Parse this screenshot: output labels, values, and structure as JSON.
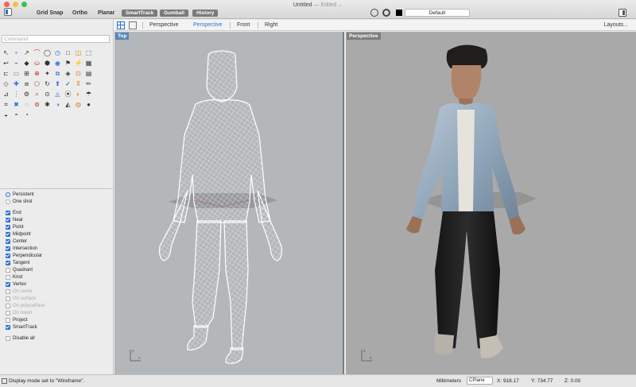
{
  "titlebar": {
    "toggles": [
      "Grid Snap",
      "Ortho",
      "Planar"
    ],
    "pills": [
      "SmartTrack",
      "Gumball",
      "History"
    ],
    "doc_name": "Untitled",
    "doc_state": " — Edited ⌄",
    "display_mode": "Default"
  },
  "sidebar": {
    "command_placeholder": "Command",
    "tool_icons": [
      "↖",
      "∘",
      "↗",
      "⌒",
      "◯",
      "◷",
      "□",
      "◫",
      "⬚",
      "↩",
      "⌁",
      "◆",
      "⛀",
      "⬢",
      "◉",
      "⚑",
      "⚡",
      "▦",
      "⊏",
      "▭",
      "⊞",
      "⊕",
      "✦",
      "⧉",
      "◈",
      "⊡",
      "▤",
      "◇",
      "✚",
      "⧈",
      "⬡",
      "↻",
      "⬆",
      "✓",
      "⊼",
      "✏",
      "⊿",
      "⋮",
      "⚙",
      "⌕",
      "⊙",
      "◬",
      "⦿",
      "◐",
      "☂",
      "⌗",
      "✖",
      "◌",
      "⊚",
      "✱",
      "◑",
      "◭",
      "◍",
      "●",
      "◒",
      "◓",
      "◔"
    ],
    "osnaps": {
      "mode": [
        {
          "label": "Persistent",
          "on": true
        },
        {
          "label": "One shot",
          "on": false
        }
      ],
      "items": [
        {
          "label": "End",
          "on": true,
          "enabled": true
        },
        {
          "label": "Near",
          "on": true,
          "enabled": true
        },
        {
          "label": "Point",
          "on": true,
          "enabled": true
        },
        {
          "label": "Midpoint",
          "on": true,
          "enabled": true
        },
        {
          "label": "Center",
          "on": true,
          "enabled": true
        },
        {
          "label": "Intersection",
          "on": true,
          "enabled": true
        },
        {
          "label": "Perpendicular",
          "on": true,
          "enabled": true
        },
        {
          "label": "Tangent",
          "on": true,
          "enabled": true
        },
        {
          "label": "Quadrant",
          "on": false,
          "enabled": true
        },
        {
          "label": "Knot",
          "on": false,
          "enabled": true
        },
        {
          "label": "Vertex",
          "on": true,
          "enabled": true
        },
        {
          "label": "On curve",
          "on": false,
          "enabled": false
        },
        {
          "label": "On surface",
          "on": false,
          "enabled": false
        },
        {
          "label": "On polysurface",
          "on": false,
          "enabled": false
        },
        {
          "label": "On mesh",
          "on": false,
          "enabled": false
        },
        {
          "label": "Project",
          "on": false,
          "enabled": true
        },
        {
          "label": "SmartTrack",
          "on": true,
          "enabled": true
        }
      ],
      "disable_all": "Disable all"
    }
  },
  "viewport_tabs": [
    "Perspective",
    "Perspective",
    "Front",
    "Right"
  ],
  "active_tab_index": 1,
  "layouts_label": "Layouts...",
  "viewports": {
    "left_label": "Top",
    "right_label": "Perspective"
  },
  "status": {
    "message": "Display mode set to \"Wireframe\".",
    "units": "Millimeters",
    "cplane": "CPlane",
    "x": "X: 918.17",
    "y": "Y: 734.77",
    "z": "Z: 0.00"
  }
}
